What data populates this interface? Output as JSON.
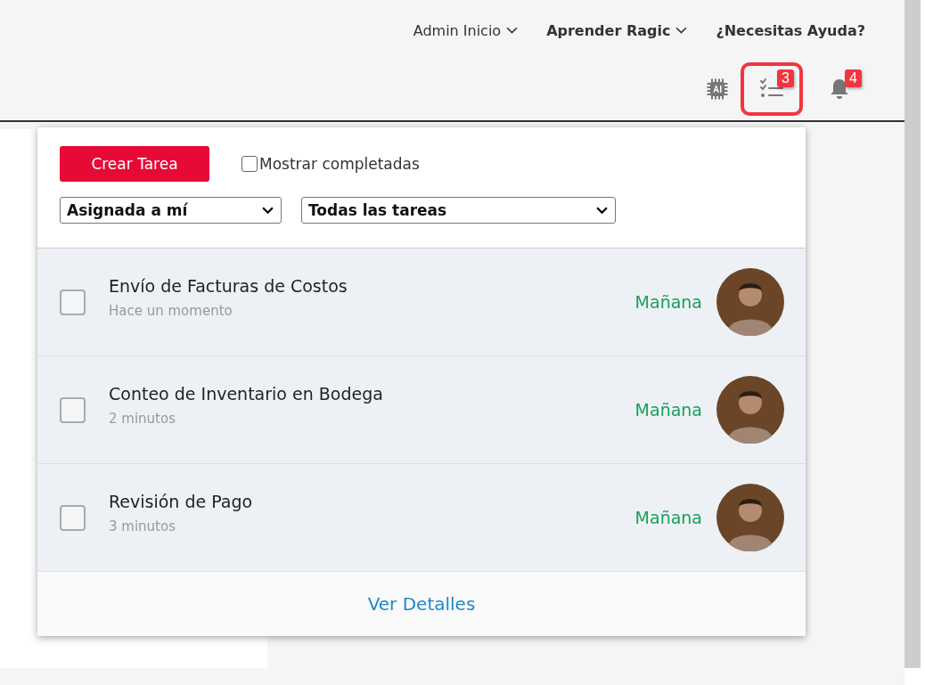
{
  "nav": [
    {
      "label": "Admin Inicio",
      "bold": false,
      "dropdown": true
    },
    {
      "label": "Aprender Ragic",
      "bold": true,
      "dropdown": true
    },
    {
      "label": "¿Necesitas Ayuda?",
      "bold": true,
      "dropdown": false
    }
  ],
  "toolbar": [
    {
      "kind": "ai",
      "selected": false
    },
    {
      "kind": "tasks",
      "badge": "3",
      "selected": true
    },
    {
      "kind": "bell",
      "badge": "4",
      "selected": false
    }
  ],
  "panel": {
    "create_button": "Crear Tarea",
    "show_completed": {
      "label": "Mostrar completadas",
      "checked": false
    },
    "assignee_select": "Asignada a mí",
    "filter_select": "Todas las tareas",
    "tasks": [
      {
        "title": "Envío de Facturas de Costos",
        "time": "Hace un momento",
        "due": "Mañana",
        "checked": false
      },
      {
        "title": "Conteo de Inventario en Bodega",
        "time": "2 minutos",
        "due": "Mañana",
        "checked": false
      },
      {
        "title": "Revisión de Pago",
        "time": "3 minutos",
        "due": "Mañana",
        "checked": false
      }
    ],
    "details_link": "Ver Detalles"
  }
}
